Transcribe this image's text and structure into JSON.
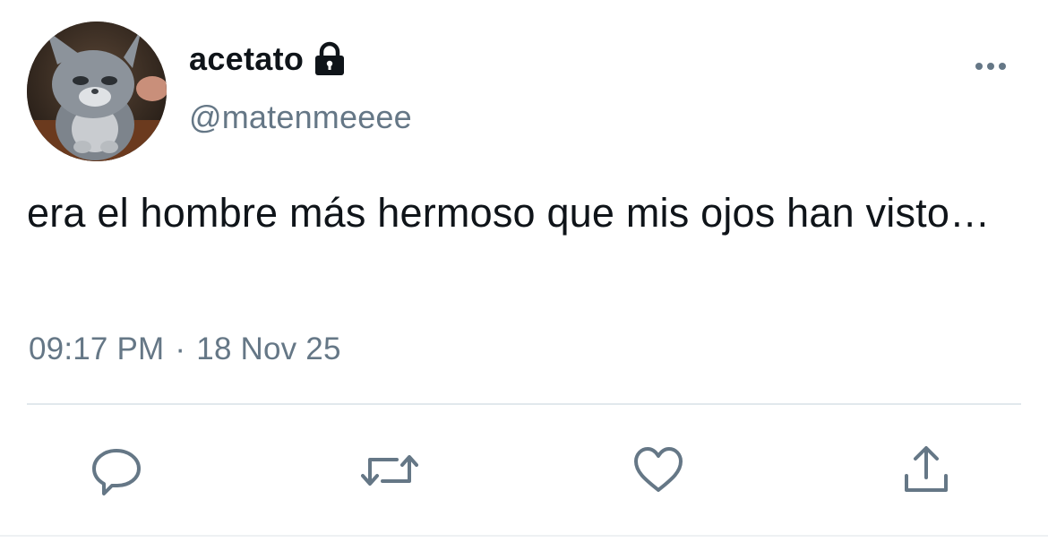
{
  "tweet": {
    "display_name": "acetato",
    "handle": "@matenmeeee",
    "text": "era el hombre más hermoso que mis ojos han visto…",
    "time": "09:17 PM",
    "separator": "·",
    "date": "18 Nov 25"
  },
  "icons": {
    "lock": "lock-icon",
    "more": "more-horizontal-icon",
    "reply": "reply-icon",
    "retweet": "retweet-icon",
    "like": "heart-icon",
    "share": "share-icon"
  },
  "colors": {
    "text": "#0f1419",
    "secondary": "#657786",
    "divider": "#e1e8ed"
  }
}
